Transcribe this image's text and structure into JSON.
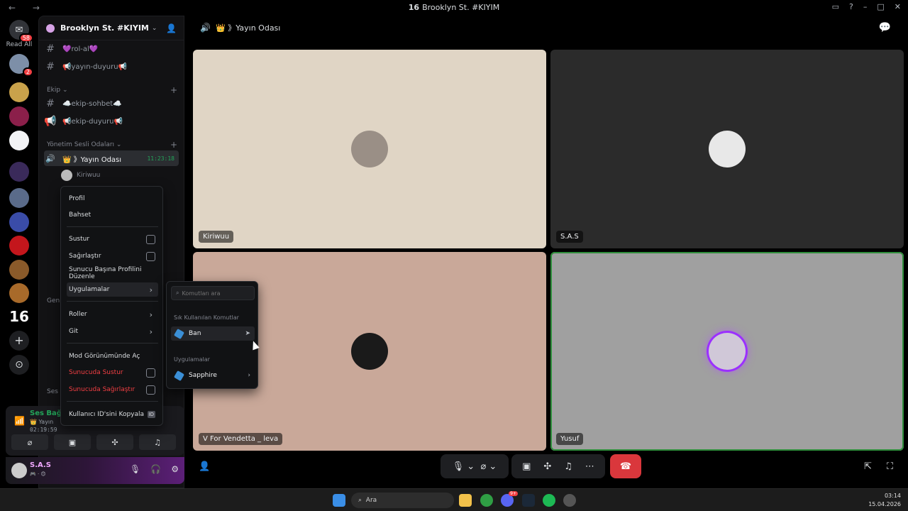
{
  "window": {
    "title_prefix": "16",
    "title": "Brooklyn St. #KIYIM",
    "controls": [
      "▭",
      "?",
      "–",
      "□",
      "✕"
    ],
    "nav": "← →"
  },
  "rail": {
    "read_all": "Read All",
    "dm_badge": "58",
    "servers": [
      {
        "color": "#7d8fa8",
        "badge": "2"
      },
      {
        "color": "#c9a24b"
      },
      {
        "color": "#8b1f4a"
      },
      {
        "color": "#f2f3f5"
      },
      {
        "color": "#3a2a5a"
      },
      {
        "color": "#5a6b8a"
      },
      {
        "color": "#3a4ca8"
      },
      {
        "color": "#c4161c"
      },
      {
        "color": "#8a5a2a"
      },
      {
        "color": "#a86a2a"
      }
    ],
    "server_16": "16",
    "add_label": "+",
    "discover_label": "⊙"
  },
  "guild": {
    "name": "Brooklyn St. #KIYIM"
  },
  "channels": {
    "top": [
      {
        "name": "💜rol-al💜"
      },
      {
        "name": "📢yayın-duyuru📢"
      }
    ],
    "cat_ekip": "Ekip",
    "ekip": [
      {
        "name": "☁️ekip-sohbet☁️"
      },
      {
        "name": "📢ekip-duyuru📢"
      }
    ],
    "cat_yonetim": "Yönetim Sesli Odaları",
    "active_voice": {
      "name": "👑 》Yayın Odası",
      "time": "11:23:18"
    },
    "member": "Kiriwuu",
    "cat_genel": "Gen",
    "cat_ses": "Ses O"
  },
  "voice_panel": {
    "status": "Ses Bağl",
    "sub": "👑 Yayın",
    "time": "02:19:59"
  },
  "user_panel": {
    "name": "S.A.S",
    "status": "🎮 · 😊"
  },
  "main": {
    "channel_title": "👑 》Yayın Odası"
  },
  "tiles": [
    {
      "name": "Kiriwuu",
      "bg": "#e0d5c5"
    },
    {
      "name": "S.A.S",
      "bg": "#2b2b2b"
    },
    {
      "name": "V For Vendetta _ leva",
      "bg": "#c9a899"
    },
    {
      "name": "Yusuf",
      "bg": "#a0a0a0"
    }
  ],
  "context_menu": {
    "profile": "Profil",
    "mention": "Bahset",
    "mute": "Sustur",
    "deafen": "Sağırlaştır",
    "edit_profile": "Sunucu Başına Profilini Düzenle",
    "apps": "Uygulamalar",
    "roles": "Roller",
    "go": "Git",
    "mod_view": "Mod Görünümünde Aç",
    "server_mute": "Sunucuda Sustur",
    "server_deafen": "Sunucuda Sağırlaştır",
    "copy_id": "Kullanıcı ID'sini Kopyala",
    "id_badge": "ID"
  },
  "submenu": {
    "search_placeholder": "Komutları ara",
    "frequent": "Sık Kullanılan Komutlar",
    "ban": "Ban",
    "apps_header": "Uygulamalar",
    "sapphire": "Sapphire"
  },
  "taskbar": {
    "search": "Ara",
    "time": "03:14",
    "date": "15.04.2026",
    "badge": "9+"
  },
  "colors": {
    "accent_green": "#23a559",
    "danger": "#f23f43",
    "hangup": "#da373c"
  }
}
